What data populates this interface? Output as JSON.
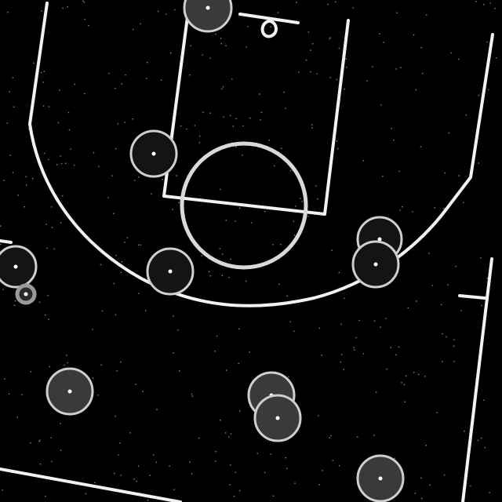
{
  "scene": {
    "type": "basketball half-court tracking diagram",
    "background_color": "#000000",
    "line_color": "#f2f2f2",
    "player_fill_dark": "#141414",
    "player_fill_gray": "#3a3a3a",
    "ball_color": "#2a2a2a"
  },
  "players": [
    {
      "id": "player-1",
      "shade": "gray"
    },
    {
      "id": "player-2",
      "shade": "dark"
    },
    {
      "id": "player-3",
      "shade": "dark"
    },
    {
      "id": "player-4",
      "shade": "dark"
    },
    {
      "id": "player-5",
      "shade": "dark"
    },
    {
      "id": "player-6",
      "shade": "dark"
    },
    {
      "id": "player-7",
      "shade": "gray"
    },
    {
      "id": "player-8",
      "shade": "gray"
    },
    {
      "id": "player-9",
      "shade": "gray"
    },
    {
      "id": "player-10",
      "shade": "gray"
    }
  ],
  "ball": {
    "visible": true
  }
}
